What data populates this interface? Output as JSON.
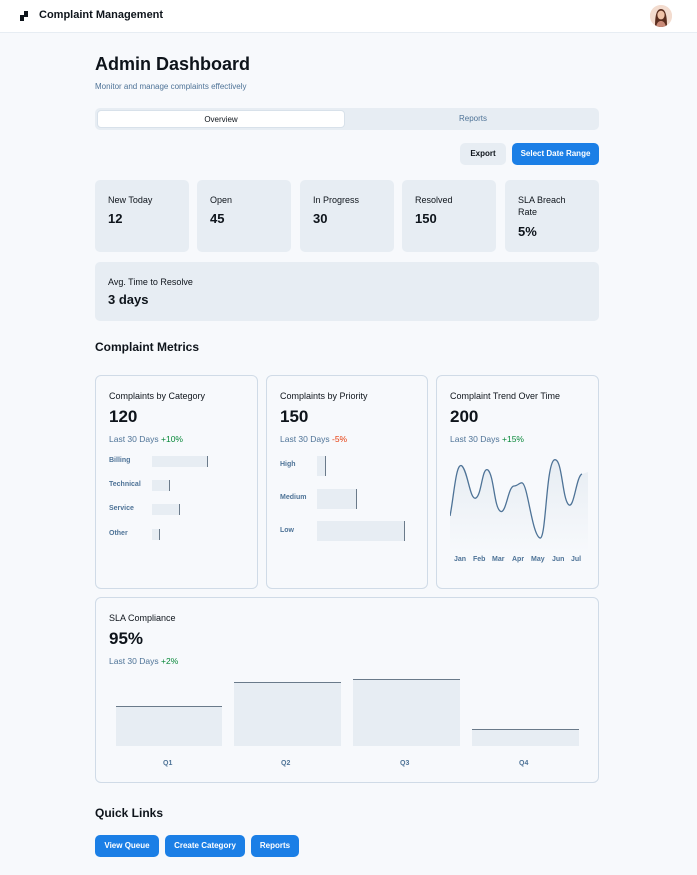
{
  "app": {
    "title": "Complaint Management"
  },
  "header": {
    "title": "Admin Dashboard",
    "subtitle": "Monitor and manage complaints effectively"
  },
  "tabs": [
    {
      "label": "Overview",
      "active": true
    },
    {
      "label": "Reports",
      "active": false
    }
  ],
  "actions": {
    "export_label": "Export",
    "date_range_label": "Select Date Range"
  },
  "stats": [
    {
      "label": "New Today",
      "value": "12"
    },
    {
      "label": "Open",
      "value": "45"
    },
    {
      "label": "In Progress",
      "value": "30"
    },
    {
      "label": "Resolved",
      "value": "150"
    },
    {
      "label": "SLA Breach Rate",
      "value": "5%"
    }
  ],
  "avg_resolve": {
    "label": "Avg. Time to Resolve",
    "value": "3 days"
  },
  "metrics_title": "Complaint Metrics",
  "metrics": {
    "category": {
      "title": "Complaints by Category",
      "value": "120",
      "period": "Last 30 Days",
      "change": "+10%",
      "chart_data": {
        "type": "bar",
        "categories": [
          "Billing",
          "Technical",
          "Service",
          "Other"
        ],
        "values": [
          100,
          33,
          50,
          15
        ]
      }
    },
    "priority": {
      "title": "Complaints by Priority",
      "value": "150",
      "period": "Last 30 Days",
      "change": "-5%",
      "chart_data": {
        "type": "bar",
        "categories": [
          "High",
          "Medium",
          "Low"
        ],
        "values": [
          10,
          45,
          100
        ]
      }
    },
    "trend": {
      "title": "Complaint Trend Over Time",
      "value": "200",
      "period": "Last 30 Days",
      "change": "+15%",
      "chart_data": {
        "type": "area",
        "categories": [
          "Jan",
          "Feb",
          "Mar",
          "Apr",
          "May",
          "Jun",
          "Jul"
        ]
      }
    },
    "sla": {
      "title": "SLA Compliance",
      "value": "95%",
      "period": "Last 30 Days",
      "change": "+2%",
      "chart_data": {
        "type": "bar",
        "categories": [
          "Q1",
          "Q2",
          "Q3",
          "Q4"
        ],
        "values": [
          60,
          95,
          100,
          25
        ]
      }
    }
  },
  "quick_links": {
    "title": "Quick Links",
    "items": [
      "View Queue",
      "Create Category",
      "Reports"
    ]
  },
  "colors": {
    "accent": "#1b7fe6",
    "positive": "#078838",
    "negative": "#e73908",
    "panel": "#e7edf3"
  }
}
